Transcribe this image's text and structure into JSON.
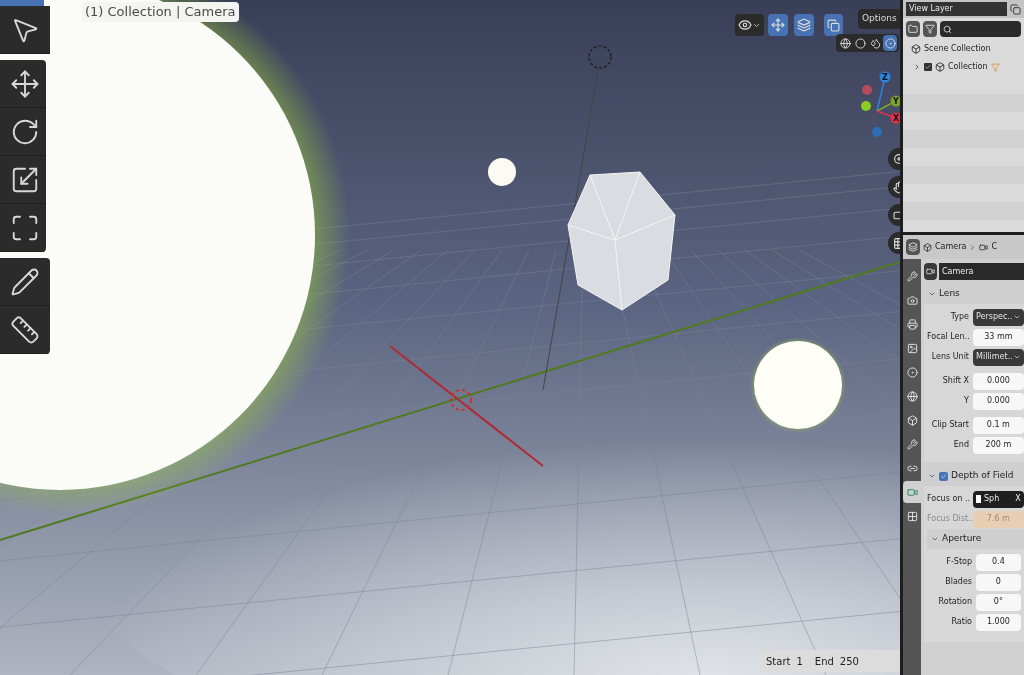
{
  "viewport": {
    "title": "(1) Collection | Camera",
    "options_button": "Options",
    "shading_modes": [
      {
        "kind": "wireframe",
        "selected": false
      },
      {
        "kind": "solid",
        "selected": false
      },
      {
        "kind": "material",
        "selected": false
      },
      {
        "kind": "rendered",
        "selected": true
      }
    ],
    "gizmo_axes": [
      {
        "label": "Z",
        "color": "#2f83e0"
      },
      {
        "label": "Y",
        "color": "#7ba52a"
      },
      {
        "label": "X",
        "color": "#e0304a"
      }
    ]
  },
  "outliner": {
    "view_layer": "View Layer",
    "items": [
      {
        "label": "Scene Collection",
        "children": [
          {
            "label": "Collection",
            "checked": true,
            "expanded": false
          }
        ]
      }
    ]
  },
  "properties": {
    "breadcrumb": [
      "Camera",
      "C"
    ],
    "data_name": "Camera",
    "tabs": [
      {
        "kind": "tool",
        "selected": false
      },
      {
        "kind": "render",
        "selected": false
      },
      {
        "kind": "output",
        "selected": false
      },
      {
        "kind": "view_layer",
        "selected": false
      },
      {
        "kind": "scene",
        "selected": false
      },
      {
        "kind": "world",
        "selected": false
      },
      {
        "kind": "object",
        "selected": false
      },
      {
        "kind": "modifiers",
        "selected": false
      },
      {
        "kind": "constraints",
        "selected": false
      },
      {
        "kind": "data",
        "selected": true
      },
      {
        "kind": "texture",
        "selected": false
      }
    ],
    "lens": {
      "title": "Lens",
      "expanded": true,
      "groups": [
        [
          {
            "kind": "dropdown",
            "label": "Type",
            "value": "Perspec.."
          },
          {
            "kind": "number",
            "label": "Focal Len..",
            "value": "33 mm"
          },
          {
            "kind": "dropdown",
            "label": "Lens Unit",
            "value": "Millimet.."
          }
        ],
        [
          {
            "kind": "number",
            "label": "Shift X",
            "value": "0.000"
          },
          {
            "kind": "number",
            "label": "Y",
            "value": "0.000"
          }
        ],
        [
          {
            "kind": "number",
            "label": "Clip Start",
            "value": "0.1 m"
          },
          {
            "kind": "number",
            "label": "End",
            "value": "200 m"
          }
        ]
      ]
    },
    "dof": {
      "title": "Depth of Field",
      "expanded": true,
      "checked": true,
      "rows": [
        {
          "kind": "object",
          "label": "Focus on ..",
          "value": "Sph",
          "clear": "X",
          "disabled": false
        },
        {
          "kind": "number",
          "label": "Focus Dist..",
          "value": "7.6 m",
          "disabled": true
        }
      ]
    },
    "aperture": {
      "title": "Aperture",
      "expanded": true,
      "rows": [
        {
          "kind": "number",
          "label": "F-Stop",
          "value": "0.4"
        },
        {
          "kind": "number",
          "label": "Blades",
          "value": "0"
        },
        {
          "kind": "number",
          "label": "Rotation",
          "value": "0°"
        },
        {
          "kind": "number",
          "label": "Ratio",
          "value": "1.000"
        }
      ]
    }
  },
  "timeline": {
    "start_label": "Start",
    "start": "1",
    "end_label": "End",
    "end": "250"
  }
}
